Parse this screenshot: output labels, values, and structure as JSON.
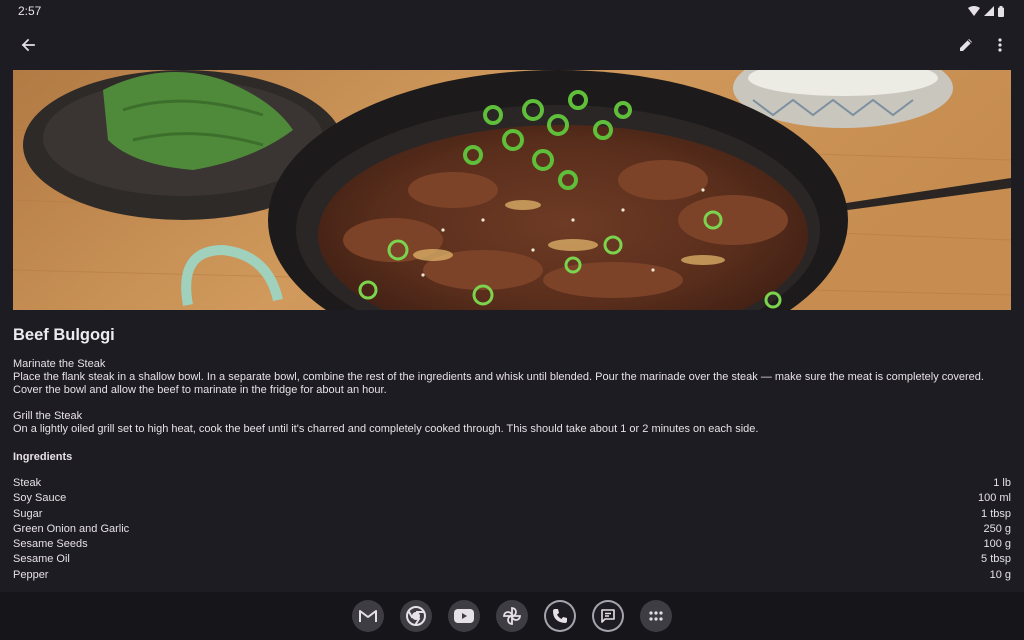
{
  "status_bar": {
    "time": "2:57"
  },
  "app_bar": {
    "back_icon": "arrow-back-icon",
    "edit_icon": "pencil-icon",
    "more_icon": "more-vert-icon"
  },
  "hero_image": {
    "subject": "beef bulgogi in cast iron pan"
  },
  "recipe": {
    "title": "Beef Bulgogi",
    "steps": [
      {
        "name": "Marinate the Steak",
        "text": "Place the flank steak in a shallow bowl. In a separate bowl, combine the rest of the ingredients and whisk until blended. Pour the marinade over the steak — make sure the meat is completely covered. Cover the bowl and allow the beef to marinate in the fridge for about an hour."
      },
      {
        "name": "Grill the Steak",
        "text": "On a lightly oiled grill set to high heat, cook the beef until it's charred and completely cooked through. This should take about 1 or 2 minutes on each side."
      }
    ],
    "ingredients_heading": "Ingredients",
    "ingredients": [
      {
        "name": "Steak",
        "amount": "1 lb"
      },
      {
        "name": "Soy Sauce",
        "amount": "100 ml"
      },
      {
        "name": "Sugar",
        "amount": "1 tbsp"
      },
      {
        "name": "Green Onion and Garlic",
        "amount": "250 g"
      },
      {
        "name": "Sesame Seeds",
        "amount": "100 g"
      },
      {
        "name": "Sesame Oil",
        "amount": "5 tbsp"
      },
      {
        "name": "Pepper",
        "amount": "10 g"
      }
    ]
  },
  "dock": [
    {
      "name": "gmail-icon"
    },
    {
      "name": "chrome-icon"
    },
    {
      "name": "youtube-icon"
    },
    {
      "name": "photos-pinwheel-icon"
    },
    {
      "name": "phone-icon"
    },
    {
      "name": "messages-icon"
    },
    {
      "name": "app-drawer-icon"
    }
  ],
  "colors": {
    "background": "#1d1c22",
    "text": "#e6e1e6",
    "nav_bar": "#16151a"
  }
}
